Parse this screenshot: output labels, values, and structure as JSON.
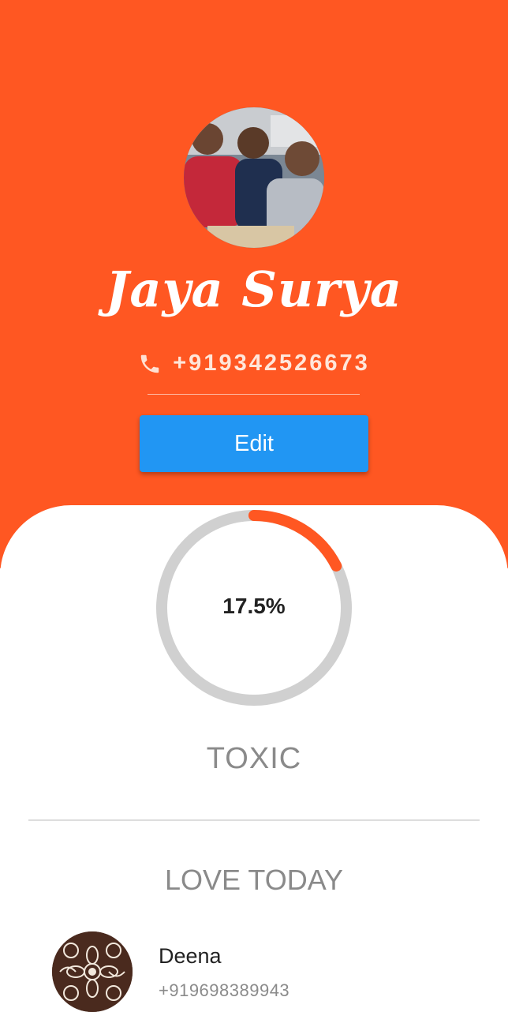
{
  "profile": {
    "name": "Jaya Surya",
    "phone": "+919342526673",
    "edit_label": "Edit"
  },
  "score": {
    "percent_label": "17.5%",
    "fraction": 0.175,
    "category": "TOXIC"
  },
  "section": {
    "title": "LOVE TODAY"
  },
  "contacts": [
    {
      "name": "Deena",
      "phone": "+919698389943"
    }
  ],
  "colors": {
    "header_bg": "#FF5722",
    "button_bg": "#2196F3",
    "ring_track": "#d0d0d0",
    "ring_progress": "#FF5722"
  },
  "icons": {
    "phone": "phone-icon"
  }
}
